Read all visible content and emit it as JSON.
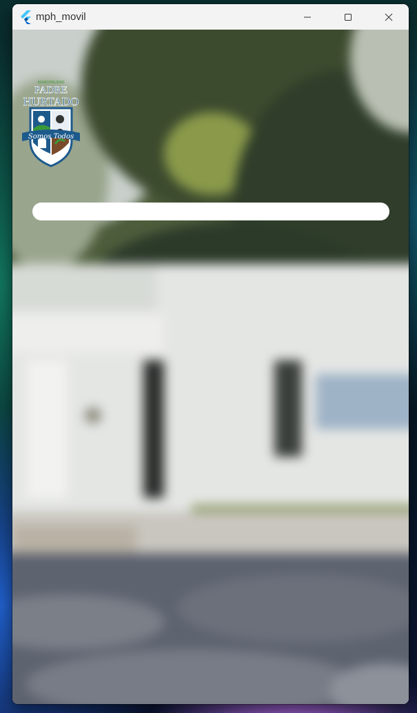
{
  "window": {
    "title": "mph_movil",
    "controls": {
      "minimize_icon": "minimize-icon",
      "maximize_icon": "maximize-icon",
      "close_icon": "close-icon"
    }
  },
  "logo": {
    "top_text": "MUNICIPALIDAD",
    "line1": "PADRE",
    "line2": "HURTADO",
    "slogan": "Somos Todos"
  },
  "search": {
    "value": "",
    "placeholder": ""
  },
  "colors": {
    "titlebar": "#f3f3f3",
    "logo_blue": "#1d5a8c",
    "logo_green": "#3a9a3a",
    "input_bg": "#ffffff"
  }
}
